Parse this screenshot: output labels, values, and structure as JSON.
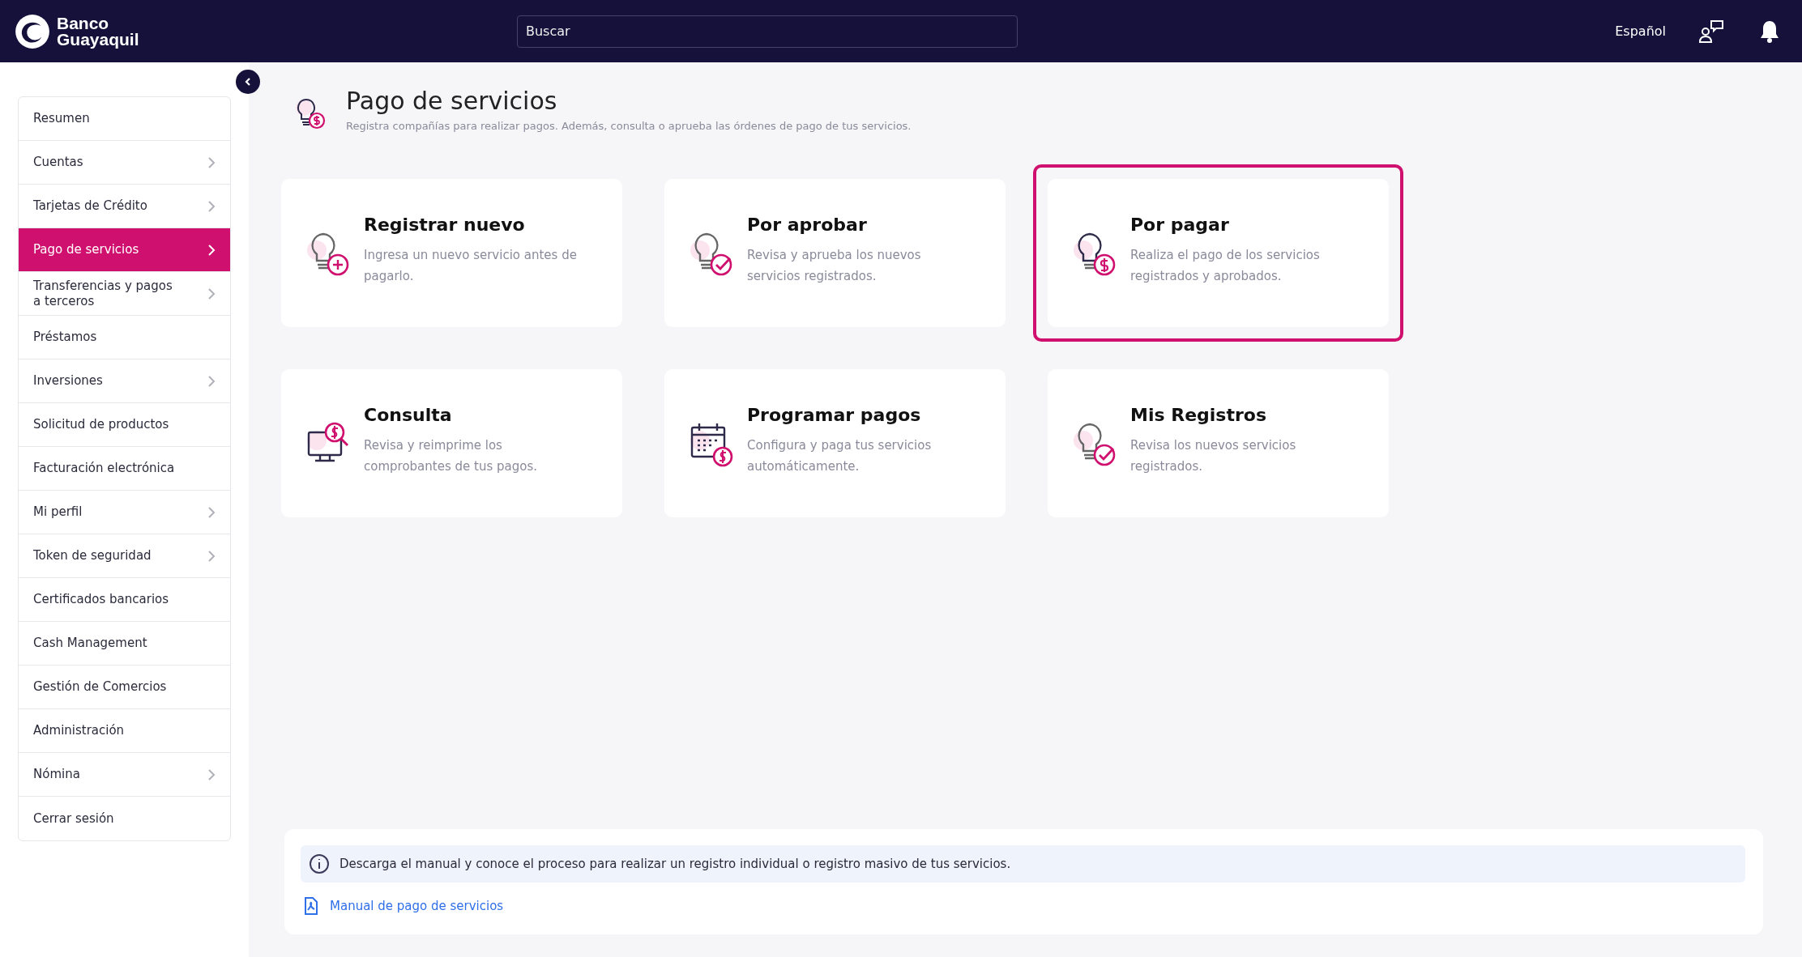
{
  "header": {
    "logo_text": [
      "Banco",
      "Guayaquil"
    ],
    "search": {
      "placeholder": "Buscar"
    },
    "language": "Español"
  },
  "sidebar": {
    "items": [
      {
        "label": "Resumen",
        "expandable": false,
        "selected": false
      },
      {
        "label": "Cuentas",
        "expandable": true,
        "selected": false
      },
      {
        "label": "Tarjetas de Crédito",
        "expandable": true,
        "selected": false
      },
      {
        "label": "Pago de servicios",
        "expandable": true,
        "selected": true
      },
      {
        "label": "Transferencias y pagos a terceros",
        "expandable": true,
        "selected": false
      },
      {
        "label": "Préstamos",
        "expandable": false,
        "selected": false
      },
      {
        "label": "Inversiones",
        "expandable": true,
        "selected": false
      },
      {
        "label": "Solicitud de productos",
        "expandable": false,
        "selected": false
      },
      {
        "label": "Facturación electrónica",
        "expandable": false,
        "selected": false
      },
      {
        "label": "Mi perfil",
        "expandable": true,
        "selected": false
      },
      {
        "label": "Token de seguridad",
        "expandable": true,
        "selected": false
      },
      {
        "label": "Certificados bancarios",
        "expandable": false,
        "selected": false
      },
      {
        "label": "Cash Management",
        "expandable": false,
        "selected": false
      },
      {
        "label": "Gestión de Comercios",
        "expandable": false,
        "selected": false
      },
      {
        "label": "Administración",
        "expandable": false,
        "selected": false
      },
      {
        "label": "Nómina",
        "expandable": true,
        "selected": false
      },
      {
        "label": "Cerrar sesión",
        "expandable": false,
        "selected": false
      }
    ]
  },
  "page": {
    "title": "Pago de servicios",
    "subtitle": "Registra compañías para realizar pagos. Además, consulta o aprueba las órdenes de pago de tus servicios."
  },
  "cards": [
    {
      "kind": "bulb-plus",
      "title": "Registrar nuevo",
      "description": "Ingresa un nuevo servicio antes de pagarlo.",
      "selected": false
    },
    {
      "kind": "bulb-check",
      "title": "Por aprobar",
      "description": "Revisa y aprueba los nuevos servicios registrados.",
      "selected": false
    },
    {
      "kind": "bulb-dollar",
      "title": "Por pagar",
      "description": "Realiza el pago de los servicios registrados y aprobados.",
      "selected": true
    },
    {
      "kind": "monitor",
      "title": "Consulta",
      "description": "Revisa y reimprime los comprobantes de tus pagos.",
      "selected": false
    },
    {
      "kind": "calendar",
      "title": "Programar pagos",
      "description": "Configura y paga tus servicios automáticamente.",
      "selected": false
    },
    {
      "kind": "bulb-check",
      "title": "Mis Registros",
      "description": "Revisa los nuevos servicios registrados.",
      "selected": false
    }
  ],
  "info": {
    "message": "Descarga el manual y conoce el proceso para realizar un registro individual o registro masivo de tus servicios.",
    "link": "Manual de pago de servicios"
  }
}
